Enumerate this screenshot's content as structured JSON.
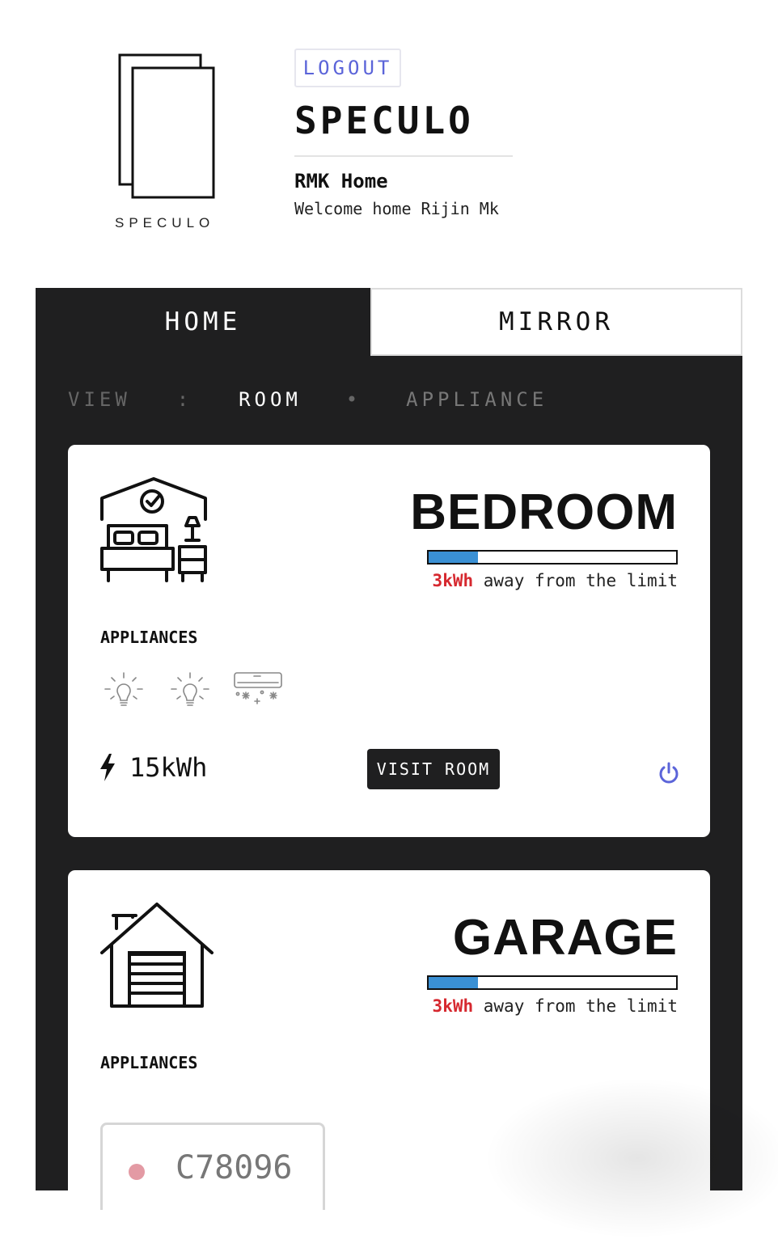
{
  "header": {
    "logo_text": "SPECULO",
    "logout_label": "LOGOUT",
    "brand": "SPECULO",
    "home_name": "RMK Home",
    "welcome": "Welcome home Rijin Mk"
  },
  "tabs": [
    {
      "label": "HOME",
      "active": true
    },
    {
      "label": "MIRROR",
      "active": false
    }
  ],
  "view": {
    "prefix": "VIEW",
    "separator": ":",
    "room": "ROOM",
    "dot": "•",
    "appliance": "APPLIANCE"
  },
  "rooms": [
    {
      "name": "BEDROOM",
      "icon": "bedroom-icon",
      "usage_fraction": 0.2,
      "limit_value": "3kWh",
      "limit_text": " away from the limit",
      "appliances_label": "APPLIANCES",
      "appliances": [
        "light-bulb-icon",
        "light-bulb-icon",
        "air-conditioner-icon"
      ],
      "energy": "15kWh",
      "visit_label": "VISIT ROOM",
      "power_color": "#5b64d9"
    },
    {
      "name": "GARAGE",
      "icon": "garage-icon",
      "usage_fraction": 0.2,
      "limit_value": "3kWh",
      "limit_text": " away from the limit",
      "appliances_label": "APPLIANCES",
      "device_code": "C78096",
      "device_status_color": "#e39aa4"
    }
  ],
  "colors": {
    "accent": "#5b64d9",
    "panel": "#1f1f20",
    "bar_fill": "#3a90d4",
    "warning": "#d6282f"
  }
}
